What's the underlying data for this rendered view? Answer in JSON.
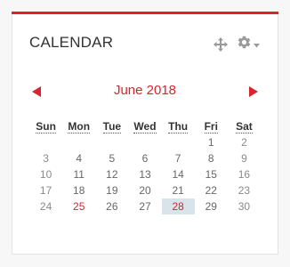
{
  "block": {
    "title": "CALENDAR",
    "accent_color": "#d9232e",
    "controls": [
      "move-icon",
      "gear-icon",
      "caret-down-icon"
    ]
  },
  "nav": {
    "month_label": "June 2018",
    "prev": "previous-month-arrow",
    "next": "next-month-arrow"
  },
  "calendar": {
    "days": [
      "Sun",
      "Mon",
      "Tue",
      "Wed",
      "Thu",
      "Fri",
      "Sat"
    ],
    "weeks": [
      [
        "",
        "",
        "",
        "",
        "",
        "1",
        "2"
      ],
      [
        "3",
        "4",
        "5",
        "6",
        "7",
        "8",
        "9"
      ],
      [
        "10",
        "11",
        "12",
        "13",
        "14",
        "15",
        "16"
      ],
      [
        "17",
        "18",
        "19",
        "20",
        "21",
        "22",
        "23"
      ],
      [
        "24",
        "25",
        "26",
        "27",
        "28",
        "29",
        "30"
      ]
    ],
    "today": "28",
    "highlighted": [
      "25"
    ],
    "today_bg": "#d9e4ea"
  }
}
